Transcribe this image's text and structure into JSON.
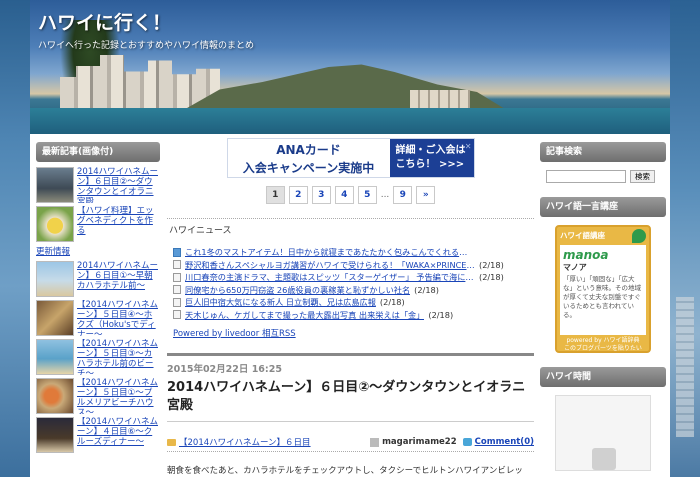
{
  "header": {
    "title": "ハワイに行く！",
    "description": "ハワイへ行った記録とおすすめやハワイ情報のまとめ"
  },
  "left": {
    "heading": "最新記事(画像付)",
    "recent": [
      {
        "title": "2014ハワイハネムーン】６日目②〜ダウンタウンとイオラニ宮殿"
      },
      {
        "title": "【ハワイ料理】エッグベネディクトを作る"
      }
    ],
    "update_label": "更新情報",
    "recent2": [
      {
        "title": "2014ハワイハネムーン】６日目①〜早朝カハラホテル前〜"
      },
      {
        "title": "【2014ハワイハネムーン】５日目④〜ホクズ（Hoku'sでディナー〜"
      },
      {
        "title": "【2014ハワイハネムーン】５日目③〜カハラホテル前のビーチ〜"
      },
      {
        "title": "【2014ハワイハネムーン】５日目①〜プルメリアビーチハウス〜"
      },
      {
        "title": "【2014ハワイハネムーン】４日目⑥〜クルーズディナー〜"
      }
    ]
  },
  "ad": {
    "line1": "ANAカード",
    "line2": "入会キャンペーン実施中",
    "cta1": "詳細・ご入会は",
    "cta2": "こちら！ >>>",
    "close": "✕"
  },
  "pager": {
    "pages": [
      "1",
      "2",
      "3",
      "4",
      "5"
    ],
    "dots": "...",
    "last": "9",
    "next": "»"
  },
  "news": {
    "title": "ハワイニュース",
    "items": [
      {
        "text": "これ1冬のマストアイテム！日中から就寝まであたたかく包みこんでくれるもの",
        "date": ""
      },
      {
        "text": "野沢和香さんスペシャルヨガ講習がハワイで受けられる！「WAKA×PRINCE W…",
        "date": "(2/18)"
      },
      {
        "text": "川口春奈の主演ドラマ、主題歌はスピッツ「スターゲイザー」 予告編で海にダイブ！",
        "date": "(2/18)"
      },
      {
        "text": "同僚宅から650万円窃盗 26歳役員の裏稼業と恥ずかしい社名",
        "date": "(2/18)"
      },
      {
        "text": "巨人旧中宿大気になる新人 日立制覇、兄は広島広報",
        "date": "(2/18)"
      },
      {
        "text": "天木じゅん、ケガしてまで撮った最大露出写真 出来栄えは「金」",
        "date": "(2/18)"
      }
    ],
    "rss": "Powered by livedoor 相互RSS"
  },
  "post": {
    "date": "2015年02月22日 16:25",
    "title": "2014ハワイハネムーン】６日目②〜ダウンタウンとイオラニ宮殿",
    "category": "【2014ハワイハネムーン】６日目",
    "author": "magarimame22",
    "comments": "Comment(0)",
    "body": "朝食を食べたあと、カハラホテルをチェックアウトし、タクシーでヒルトンハワイアンビレッ"
  },
  "right": {
    "search_heading": "記事検索",
    "search_button": "検索",
    "dict_heading": "ハワイ語一言講座",
    "dict": {
      "title": "ハワイ語講座",
      "word": "manoa",
      "reading": "マノア",
      "definition": "「厚い」「頑固な」「広大な」という意味。その地域が厚くて丈夫な別盤ですぐいるためとも言われている。",
      "footer": "powered by ハワイ語辞典\nこのブログパーツを貼りたい"
    },
    "time_heading": "ハワイ時間"
  }
}
